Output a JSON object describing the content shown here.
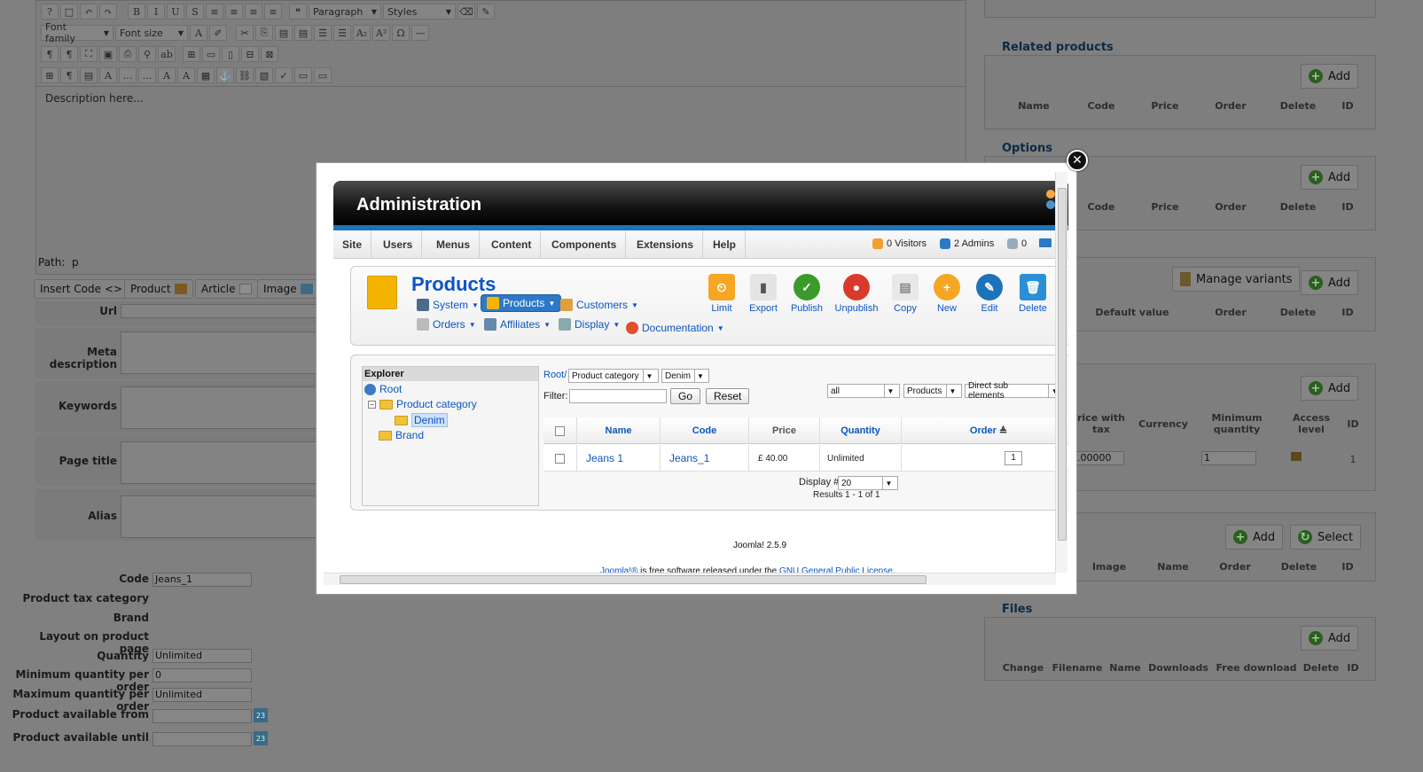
{
  "background": {
    "editor": {
      "format_select": "Paragraph",
      "styles_select": "Styles",
      "font_family_select": "Font family",
      "font_size_select": "Font size",
      "content_placeholder": "Description here...",
      "path_label": "Path:",
      "path_value": "p"
    },
    "insert_buttons": [
      "Insert Code",
      "Product",
      "Article",
      "Image"
    ],
    "left_fields": [
      "Url",
      "Meta description",
      "Keywords",
      "Page title",
      "Alias"
    ],
    "bottom_fields": [
      {
        "label": "Code",
        "value": "Jeans_1"
      },
      {
        "label": "Product tax category",
        "value": ""
      },
      {
        "label": "Brand",
        "value": ""
      },
      {
        "label": "Layout on product page",
        "value": ""
      },
      {
        "label": "Quantity",
        "value": "Unlimited"
      },
      {
        "label": "Minimum quantity per order",
        "value": "0"
      },
      {
        "label": "Maximum quantity per order",
        "value": "Unlimited"
      },
      {
        "label": "Product available from",
        "value": ""
      },
      {
        "label": "Product available until",
        "value": ""
      }
    ],
    "right_sections": {
      "related": {
        "title": "Related products",
        "add": "Add",
        "columns": [
          "Name",
          "Code",
          "Price",
          "Order",
          "Delete",
          "ID"
        ]
      },
      "options": {
        "title": "Options",
        "add": "Add",
        "columns": [
          "Code",
          "Price",
          "Order",
          "Delete",
          "ID"
        ]
      },
      "variants": {
        "manage": "Manage variants",
        "add": "Add",
        "columns": [
          "Default value",
          "Order",
          "Delete",
          "ID"
        ]
      },
      "prices": {
        "add": "Add",
        "columns": [
          "rice with tax",
          "Currency",
          "Minimum quantity",
          "Access level",
          "ID"
        ],
        "row": {
          "price": ".00000",
          "min_qty": "1",
          "id": "1"
        }
      },
      "images": {
        "add": "Add",
        "select": "Select",
        "columns": [
          "Image",
          "Name",
          "Order",
          "Delete",
          "ID"
        ]
      },
      "files": {
        "title": "Files",
        "add": "Add",
        "columns": [
          "Change",
          "Filename",
          "Name",
          "Downloads",
          "Free download",
          "Delete",
          "ID"
        ]
      }
    }
  },
  "modal": {
    "header_title": "Administration",
    "menu": [
      "Site",
      "Users",
      "Menus",
      "Content",
      "Components",
      "Extensions",
      "Help"
    ],
    "stats": {
      "visitors": "0 Visitors",
      "admins": "2 Admins",
      "messages": "0"
    },
    "page_title": "Products",
    "submenus": [
      "System",
      "Products",
      "Customers",
      "Orders",
      "Affiliates",
      "Display",
      "Documentation"
    ],
    "tools": [
      "Limit",
      "Export",
      "Publish",
      "Unpublish",
      "Copy",
      "New",
      "Edit",
      "Delete"
    ],
    "tool_colors": {
      "limit": "#f5a623",
      "export": "#cccccc",
      "publish": "#3a9a2a",
      "unpublish": "#d93a2b",
      "copy": "#d6d6d6",
      "new": "#f5a623",
      "edit": "#1d73b8",
      "delete": "#2a8fd6"
    },
    "explorer": {
      "title": "Explorer",
      "root": "Root",
      "category": "Product category",
      "selected": "Denim",
      "brand": "Brand"
    },
    "breadcrumb": {
      "root": "Root/",
      "cat_select": "Product category",
      "sub_select": "Denim"
    },
    "filter": {
      "label": "Filter:",
      "value": "",
      "go": "Go",
      "reset": "Reset"
    },
    "selects": {
      "state": "all",
      "type": "Products",
      "scope": "Direct sub elements"
    },
    "grid": {
      "columns": [
        "Name",
        "Code",
        "Price",
        "Quantity",
        "Order"
      ],
      "rows": [
        {
          "name": "Jeans 1",
          "code": "Jeans_1",
          "price": "£ 40.00",
          "quantity": "Unlimited",
          "order": "1"
        }
      ]
    },
    "pagination": {
      "display_label": "Display #",
      "display_value": "20",
      "results": "Results 1 - 1 of 1"
    },
    "footer": {
      "version": "Joomla! 2.5.9",
      "license_prefix": "Joomla!®",
      "license_mid": " is free software released under the ",
      "license_link": "GNU General Public License",
      "license_suffix": "."
    }
  }
}
